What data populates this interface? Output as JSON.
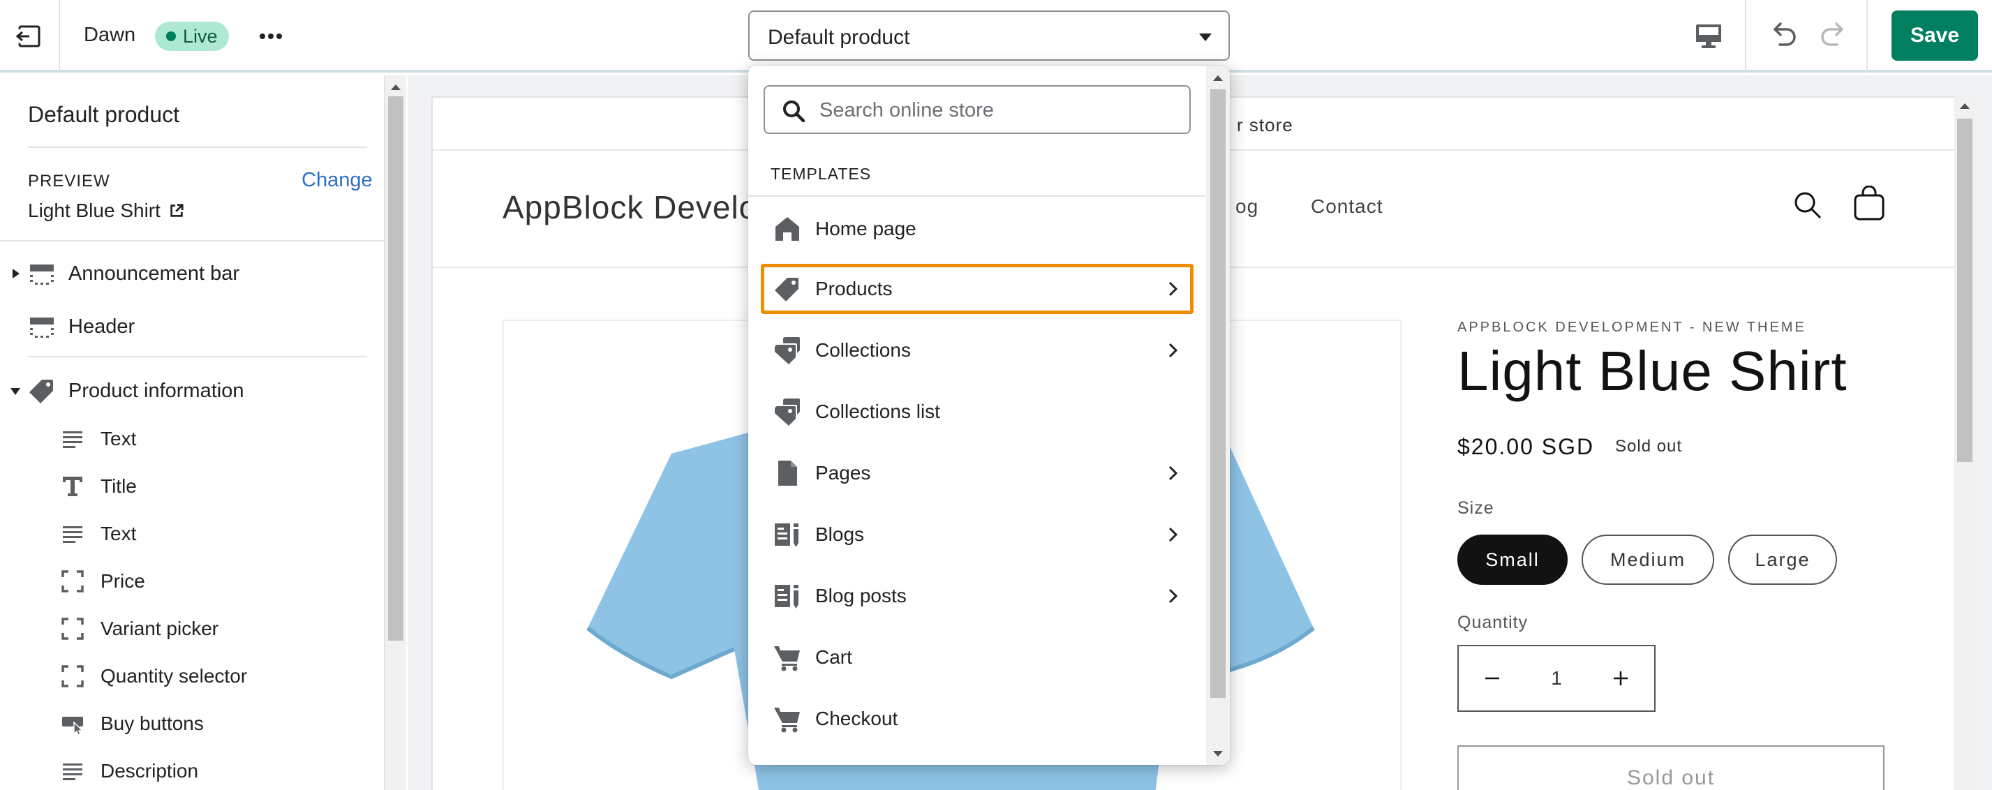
{
  "topbar": {
    "theme_name": "Dawn",
    "status_badge": "Live",
    "template_selected": "Default product",
    "save_label": "Save",
    "colors": {
      "save": "#008060",
      "badge_bg": "#aee9d1",
      "badge_dot": "#007f5f"
    }
  },
  "sidebar": {
    "title": "Default product",
    "preview_label": "PREVIEW",
    "change_label": "Change",
    "preview_value": "Light Blue Shirt",
    "sections": [
      {
        "label": "Announcement bar",
        "icon": "section-icon",
        "collapsible": true,
        "expanded": false
      },
      {
        "label": "Header",
        "icon": "section-icon",
        "collapsible": false
      },
      {
        "label": "Product information",
        "icon": "tag-icon",
        "collapsible": true,
        "expanded": true
      }
    ],
    "blocks": [
      {
        "label": "Text",
        "icon": "text-lines-icon"
      },
      {
        "label": "Title",
        "icon": "title-t-icon"
      },
      {
        "label": "Text",
        "icon": "text-lines-icon"
      },
      {
        "label": "Price",
        "icon": "dashed-frame-icon"
      },
      {
        "label": "Variant picker",
        "icon": "dashed-frame-icon"
      },
      {
        "label": "Quantity selector",
        "icon": "dashed-frame-icon"
      },
      {
        "label": "Buy buttons",
        "icon": "buy-buttons-icon"
      },
      {
        "label": "Description",
        "icon": "text-lines-icon"
      }
    ]
  },
  "dropdown": {
    "search_placeholder": "Search online store",
    "section_label": "TEMPLATES",
    "highlight_color": "#f08c00",
    "items": [
      {
        "label": "Home page",
        "icon": "home-icon",
        "has_children": false,
        "highlighted": false
      },
      {
        "label": "Products",
        "icon": "tag-icon",
        "has_children": true,
        "highlighted": true
      },
      {
        "label": "Collections",
        "icon": "collections-icon",
        "has_children": true,
        "highlighted": false
      },
      {
        "label": "Collections list",
        "icon": "collections-icon",
        "has_children": false,
        "highlighted": false
      },
      {
        "label": "Pages",
        "icon": "page-icon",
        "has_children": true,
        "highlighted": false
      },
      {
        "label": "Blogs",
        "icon": "blog-icon",
        "has_children": true,
        "highlighted": false
      },
      {
        "label": "Blog posts",
        "icon": "blog-icon",
        "has_children": true,
        "highlighted": false
      },
      {
        "label": "Cart",
        "icon": "cart-icon",
        "has_children": false,
        "highlighted": false
      },
      {
        "label": "Checkout",
        "icon": "cart-icon",
        "has_children": false,
        "highlighted": false
      }
    ]
  },
  "store": {
    "announcement": "r store",
    "logo": "AppBlock Develo",
    "nav": [
      "og",
      "Contact"
    ],
    "vendor": "APPBLOCK DEVELOPMENT - NEW THEME",
    "product_title": "Light Blue Shirt",
    "price": "$20.00 SGD",
    "sold_badge": "Sold out",
    "size_label": "Size",
    "sizes": [
      "Small",
      "Medium",
      "Large"
    ],
    "selected_size": "Small",
    "quantity_label": "Quantity",
    "quantity": "1",
    "sold_button": "Sold out",
    "shirt_color": "#8ec3e6"
  }
}
